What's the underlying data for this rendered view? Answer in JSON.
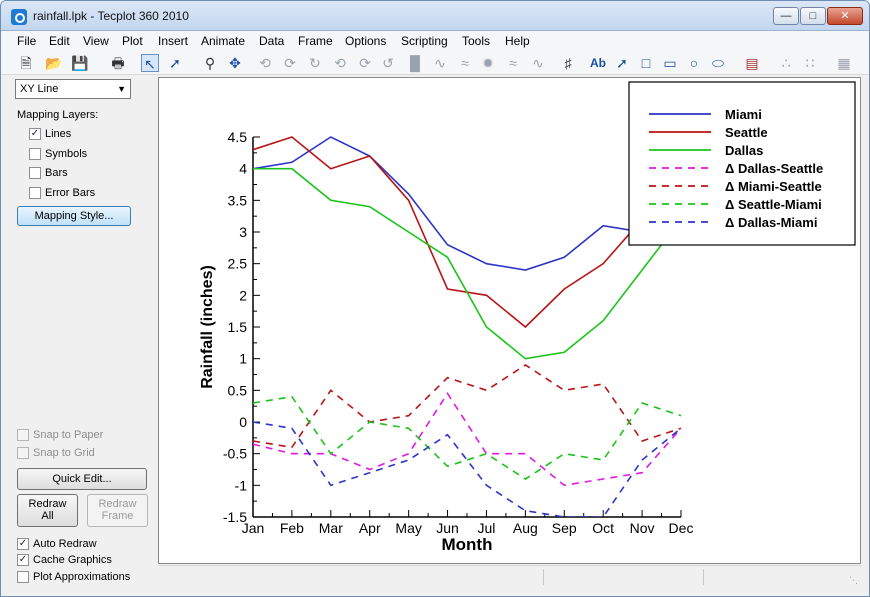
{
  "window": {
    "title": "rainfall.lpk - Tecplot 360 2010"
  },
  "menu": [
    "File",
    "Edit",
    "View",
    "Plot",
    "Insert",
    "Animate",
    "Data",
    "Frame",
    "Options",
    "Scripting",
    "Tools",
    "Help"
  ],
  "toolbar": {
    "text_tool_label": "Ab"
  },
  "sidebar": {
    "plot_type": "XY Line",
    "mapping_layers_label": "Mapping Layers:",
    "layers": [
      {
        "label": "Lines",
        "checked": true
      },
      {
        "label": "Symbols",
        "checked": false
      },
      {
        "label": "Bars",
        "checked": false
      },
      {
        "label": "Error Bars",
        "checked": false
      }
    ],
    "mapping_style_label": "Mapping Style...",
    "snap_paper_label": "Snap to Paper",
    "snap_grid_label": "Snap to Grid",
    "quick_edit_label": "Quick Edit...",
    "redraw_all_line1": "Redraw",
    "redraw_all_line2": "All",
    "redraw_frame_line1": "Redraw",
    "redraw_frame_line2": "Frame",
    "auto_redraw_label": "Auto Redraw",
    "auto_redraw_checked": true,
    "cache_graphics_label": "Cache Graphics",
    "cache_graphics_checked": true,
    "plot_approx_label": "Plot Approximations",
    "plot_approx_checked": false
  },
  "chart_data": {
    "type": "line",
    "categories": [
      "Jan",
      "Feb",
      "Mar",
      "Apr",
      "May",
      "Jun",
      "Jul",
      "Aug",
      "Sep",
      "Oct",
      "Nov",
      "Dec"
    ],
    "xlabel": "Month",
    "ylabel": "Rainfall (inches)",
    "ylim": [
      -1.5,
      4.5
    ],
    "yticks": [
      "-1.5",
      "-1",
      "-0.5",
      "0",
      "0.5",
      "1",
      "1.5",
      "2",
      "2.5",
      "3",
      "3.5",
      "4",
      "4.5"
    ],
    "grid": false,
    "legend_position": "top-right",
    "series": [
      {
        "name": "Miami",
        "color": "#2b35c8",
        "dashed": false,
        "values": [
          4.0,
          4.1,
          4.5,
          4.2,
          3.6,
          2.8,
          2.5,
          2.4,
          2.6,
          3.1,
          3.0,
          3.3
        ]
      },
      {
        "name": "Seattle",
        "color": "#b81414",
        "dashed": false,
        "values": [
          4.3,
          4.5,
          4.0,
          4.2,
          3.5,
          2.1,
          2.0,
          1.5,
          2.1,
          2.5,
          3.2,
          3.4
        ]
      },
      {
        "name": "Dallas",
        "color": "#18c418",
        "dashed": false,
        "values": [
          4.0,
          4.0,
          3.5,
          3.4,
          3.0,
          2.6,
          1.5,
          1.0,
          1.1,
          1.6,
          2.4,
          3.2
        ]
      },
      {
        "name": "Δ Dallas-Seattle",
        "color": "#e018e0",
        "dashed": true,
        "values": [
          -0.35,
          -0.5,
          -0.5,
          -0.75,
          -0.5,
          0.45,
          -0.5,
          -0.5,
          -1.0,
          -0.9,
          -0.8,
          -0.1
        ]
      },
      {
        "name": "Δ Miami-Seattle",
        "color": "#b81414",
        "dashed": true,
        "values": [
          -0.3,
          -0.4,
          0.5,
          0.0,
          0.1,
          0.7,
          0.5,
          0.9,
          0.5,
          0.6,
          -0.3,
          -0.1
        ]
      },
      {
        "name": "Δ Seattle-Miami",
        "color": "#18c418",
        "dashed": true,
        "values": [
          0.3,
          0.4,
          -0.5,
          0.0,
          -0.1,
          -0.7,
          -0.5,
          -0.9,
          -0.5,
          -0.6,
          0.3,
          0.1
        ]
      },
      {
        "name": "Δ Dallas-Miami",
        "color": "#2b35c8",
        "dashed": true,
        "values": [
          0.0,
          -0.1,
          -1.0,
          -0.8,
          -0.6,
          -0.2,
          -1.0,
          -1.4,
          -1.5,
          -1.5,
          -0.6,
          -0.1
        ]
      }
    ]
  }
}
